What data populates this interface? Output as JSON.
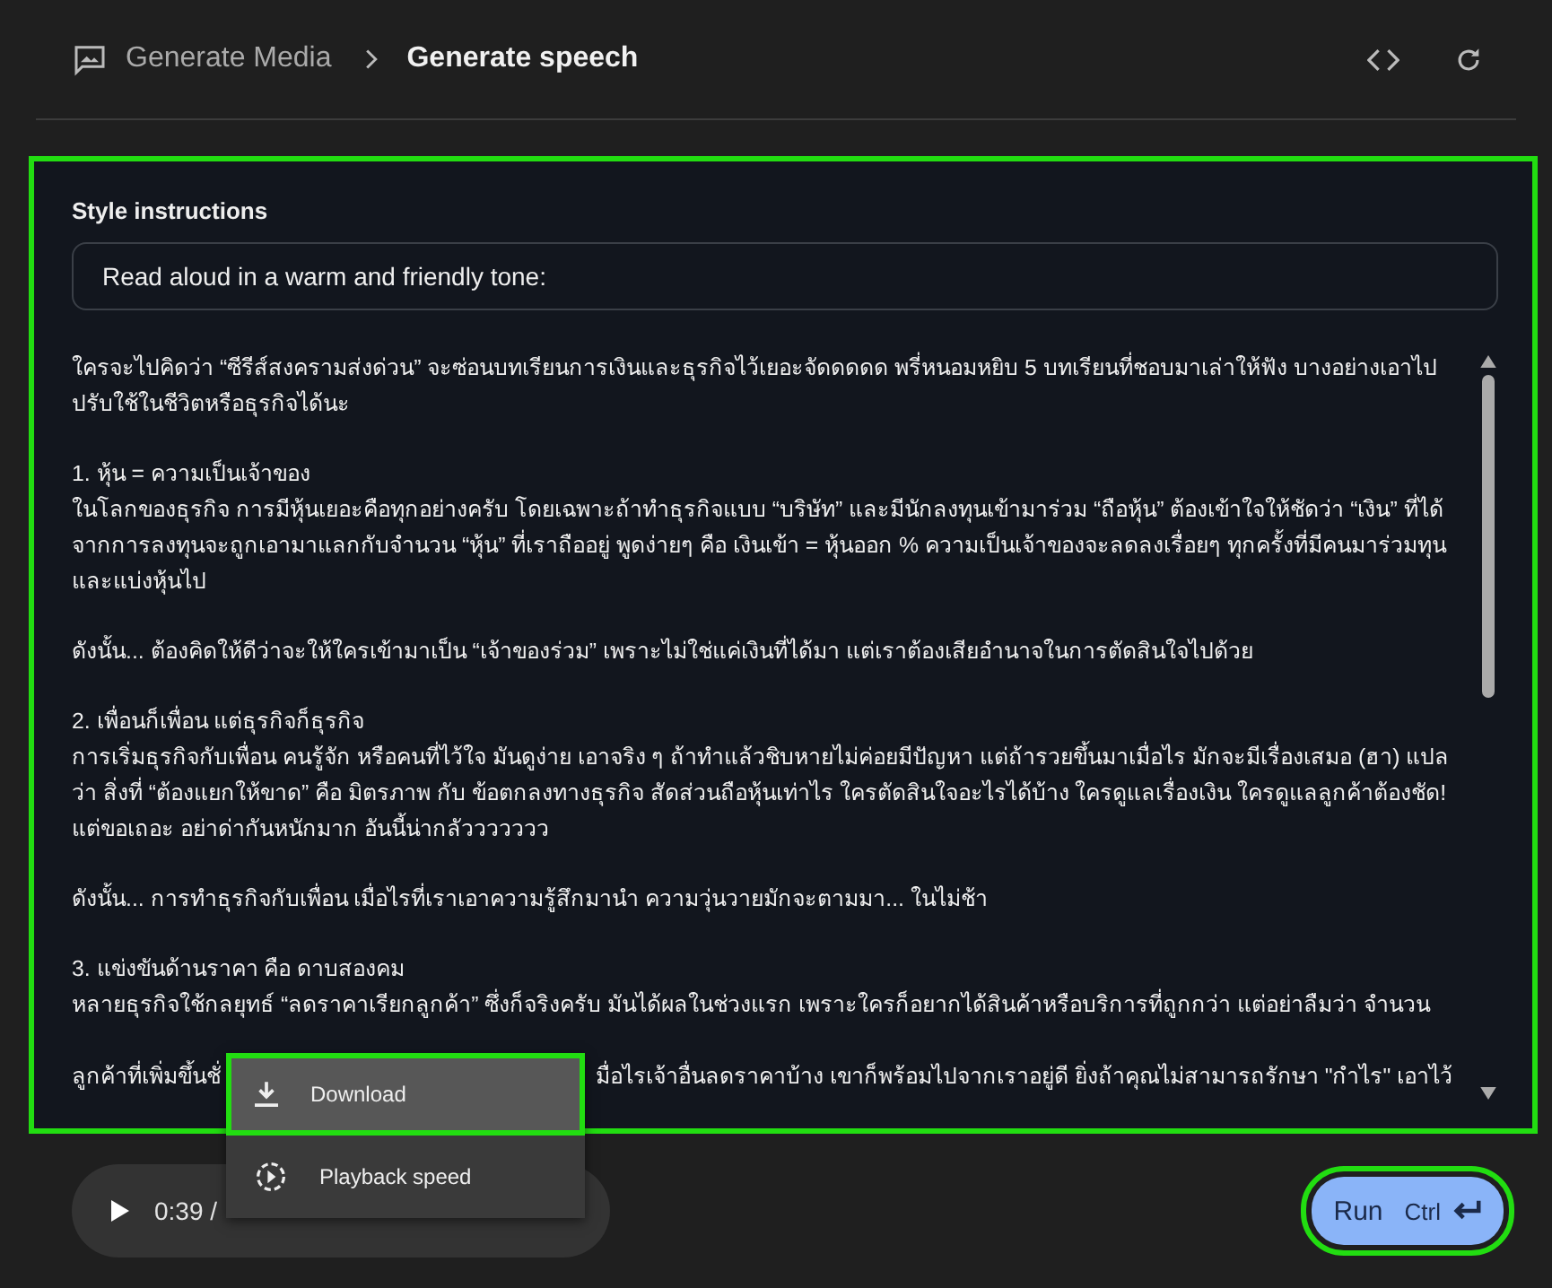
{
  "header": {
    "parent": "Generate Media",
    "current": "Generate speech"
  },
  "style_instructions": {
    "label": "Style instructions",
    "value": "Read aloud in a warm and friendly tone:"
  },
  "script": {
    "groups": [
      {
        "lines": [
          "ใครจะไปคิดว่า “ซีรีส์สงครามส่งด่วน” จะซ่อนบทเรียนการเงินและธุรกิจไว้เยอะจัดดดดด พรี่หนอมหยิบ 5 บทเรียนที่ชอบมาเล่าให้ฟัง บางอย่างเอาไปปรับใช้ในชีวิตหรือธุรกิจได้นะ"
        ]
      },
      {
        "lines": [
          "1. หุ้น = ความเป็นเจ้าของ",
          "ในโลกของธุรกิจ การมีหุ้นเยอะคือทุกอย่างครับ โดยเฉพาะถ้าทำธุรกิจแบบ “บริษัท” และมีนักลงทุนเข้ามาร่วม “ถือหุ้น” ต้องเข้าใจให้ชัดว่า “เงิน” ที่ได้จากการลงทุนจะถูกเอามาแลกกับจำนวน “หุ้น” ที่เราถืออยู่ พูดง่ายๆ คือ เงินเข้า = หุ้นออก % ความเป็นเจ้าของจะลดลงเรื่อยๆ ทุกครั้งที่มีคนมาร่วมทุนและแบ่งหุ้นไป"
        ]
      },
      {
        "lines": [
          "ดังนั้น... ต้องคิดให้ดีว่าจะให้ใครเข้ามาเป็น “เจ้าของร่วม” เพราะไม่ใช่แค่เงินที่ได้มา แต่เราต้องเสียอำนาจในการตัดสินใจไปด้วย"
        ]
      },
      {
        "lines": [
          "2. เพื่อนก็เพื่อน แต่ธุรกิจก็ธุรกิจ",
          "การเริ่มธุรกิจกับเพื่อน คนรู้จัก หรือคนที่ไว้ใจ มันดูง่าย เอาจริง ๆ ถ้าทำแล้วชิบหายไม่ค่อยมีปัญหา แต่ถ้ารวยขึ้นมาเมื่อไร มักจะมีเรื่องเสมอ (ฮา) แปลว่า สิ่งที่ “ต้องแยกให้ขาด” คือ มิตรภาพ กับ ข้อตกลงทางธุรกิจ สัดส่วนถือหุ้นเท่าไร ใครตัดสินใจอะไรได้บ้าง ใครดูแลเรื่องเงิน ใครดูแลลูกค้าต้องชัด! แต่ขอเถอะ อย่าด่ากันหนักมาก อันนี้น่ากลัววววววว"
        ]
      },
      {
        "lines": [
          "ดังนั้น... การทำธุรกิจกับเพื่อน เมื่อไรที่เราเอาความรู้สึกมานำ ความวุ่นวายมักจะตามมา... ในไม่ช้า"
        ]
      },
      {
        "lines": [
          "3. แข่งขันด้านราคา คือ ดาบสองคม",
          "หลายธุรกิจใช้กลยุทธ์ “ลดราคาเรียกลูกค้า” ซึ่งก็จริงครับ มันได้ผลในช่วงแรก เพราะใครก็อยากได้สินค้าหรือบริการที่ถูกกว่า แต่อย่าลืมว่า จำนวน"
        ]
      }
    ],
    "partial_line": {
      "left": "ลูกค้าที่เพิ่มขึ้นชั่",
      "right": "มื่อไรเจ้าอื่นลดราคาบ้าง เขาก็พร้อมไปจากเราอยู่ดี ยิ่งถ้าคุณไม่สามารถรักษา \"กำไร\" เอาไว้"
    }
  },
  "player": {
    "time": "0:39 /"
  },
  "menu": [
    {
      "kind": "download",
      "label": "Download",
      "selected": true
    },
    {
      "kind": "speed",
      "label": "Playback speed",
      "selected": false
    }
  ],
  "run_button": {
    "label": "Run",
    "shortcut": "Ctrl"
  }
}
